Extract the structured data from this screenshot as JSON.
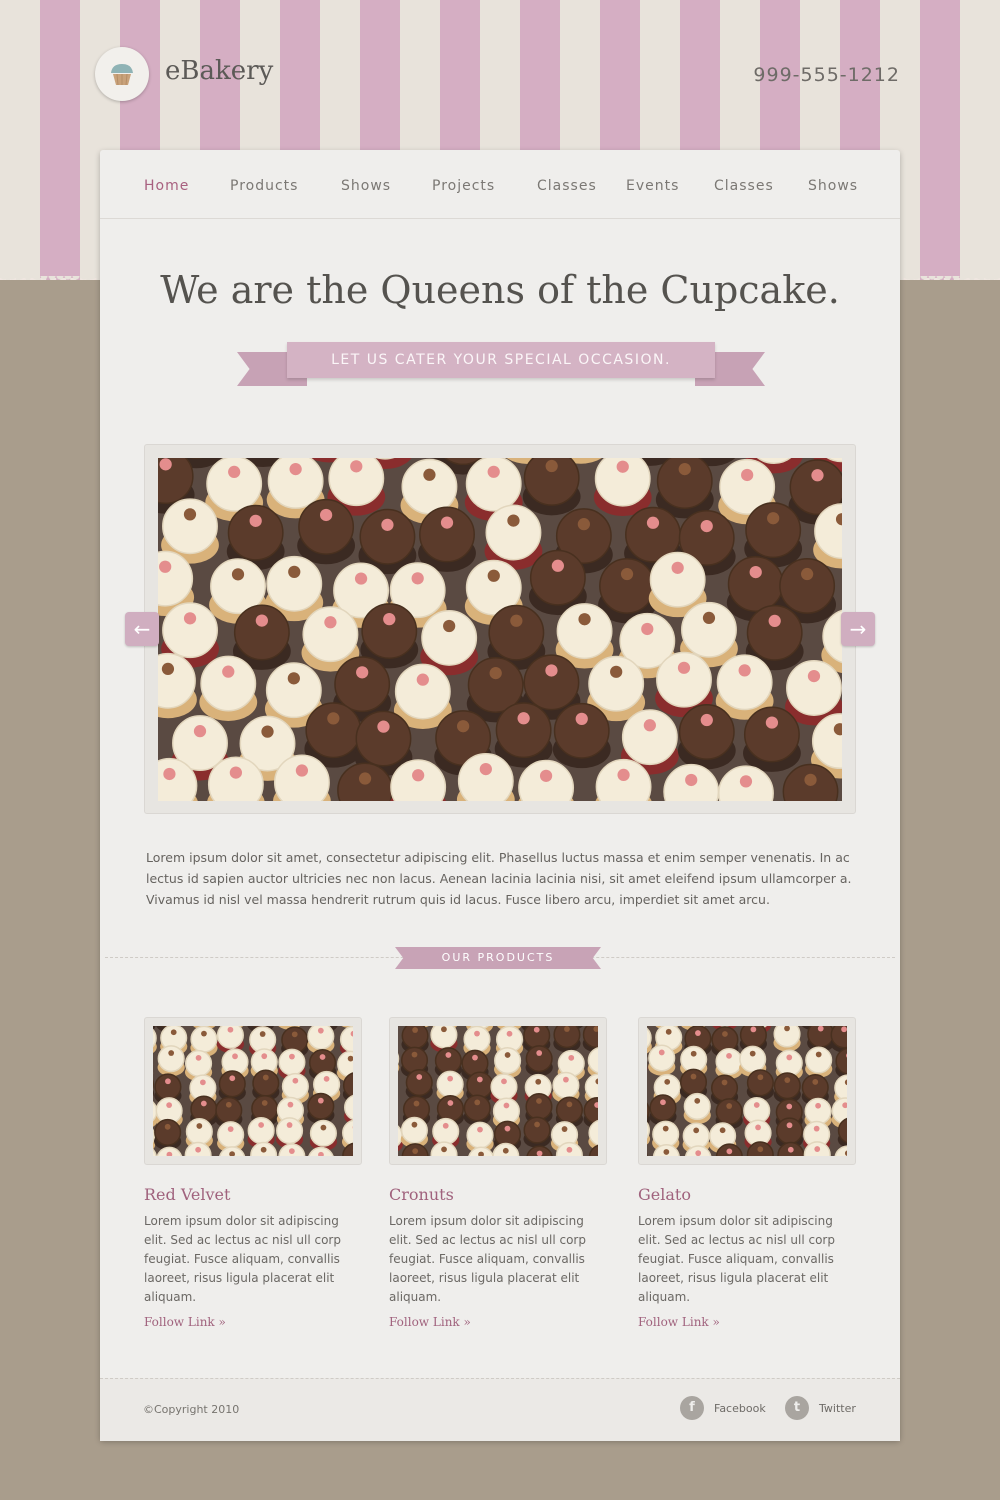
{
  "header": {
    "brand": "eBakery",
    "phone": "999-555-1212",
    "logo_icon": "cupcake-icon"
  },
  "nav": {
    "items": [
      "Home",
      "Products",
      "Shows",
      "Projects",
      "Classes",
      "Events",
      "Classes",
      "Shows"
    ],
    "active": "Home"
  },
  "hero": {
    "headline": "We are the Queens of the Cupcake.",
    "ribbon": "LET US CATER YOUR SPECIAL OCCASION."
  },
  "slider": {
    "prev": "←",
    "next": "→"
  },
  "intro": "Lorem ipsum dolor sit amet, consectetur adipiscing elit. Phasellus luctus massa et enim semper venenatis. In ac lectus id sapien auctor ultricies nec non lacus. Aenean lacinia lacinia nisi, sit amet eleifend ipsum ullamcorper a. Vivamus id nisl vel massa hendrerit rutrum quis id lacus. Fusce libero arcu, imperdiet sit amet arcu.",
  "products": {
    "section_label": "OUR PRODUCTS",
    "items": [
      {
        "title": "Red Velvet",
        "text": "Lorem ipsum dolor sit adipiscing elit. Sed ac lectus ac nisl ull corp feugiat. Fusce aliquam, convallis laoreet, risus ligula placerat  elit aliquam.",
        "link": "Follow Link »"
      },
      {
        "title": "Cronuts",
        "text": "Lorem ipsum dolor sit adipiscing elit. Sed ac lectus ac nisl ull corp feugiat. Fusce aliquam, convallis laoreet, risus ligula placerat  elit aliquam.",
        "link": "Follow Link »"
      },
      {
        "title": "Gelato",
        "text": "Lorem ipsum dolor sit adipiscing elit. Sed ac lectus ac nisl ull corp feugiat. Fusce aliquam, convallis laoreet, risus ligula placerat  elit aliquam.",
        "link": "Follow Link »"
      }
    ]
  },
  "footer": {
    "copyright": "©Copyright 2010",
    "facebook": "Facebook",
    "twitter": "Twitter"
  },
  "colors": {
    "accent": "#a0627d",
    "stripe_pink": "#d5aec3",
    "background": "#a99d8c"
  }
}
